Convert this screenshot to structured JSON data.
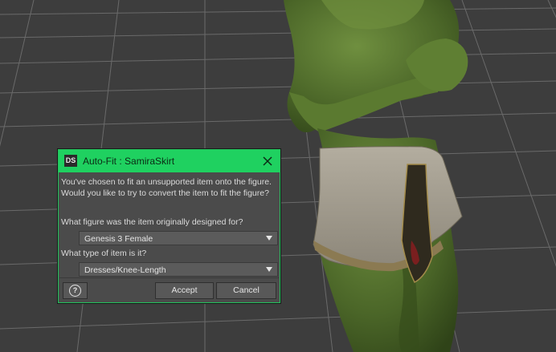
{
  "dialog": {
    "title": "Auto-Fit : SamiraSkirt",
    "logo_text": "DS",
    "message_line1": "You've chosen to fit an unsupported item onto the figure.",
    "message_line2": "Would you like to try to convert the item to fit the figure?",
    "figure_question": "What figure was the item originally designed for?",
    "figure_selected": "Genesis 3 Female",
    "item_type_question": "What type of item is it?",
    "item_type_selected": "Dresses/Knee-Length",
    "help_label": "?",
    "accept_label": "Accept",
    "cancel_label": "Cancel"
  },
  "colors": {
    "titlebar": "#1fd160",
    "dialog_bg": "#4b4b4b",
    "viewport_bg": "#3d3d3d",
    "figure_skin": "#4f6a2c",
    "skirt_fabric": "#a39d8f"
  },
  "icons": {
    "app_logo": "daz-studio-logo",
    "close": "close-icon",
    "help": "help-icon",
    "dropdown": "chevron-down-icon"
  }
}
